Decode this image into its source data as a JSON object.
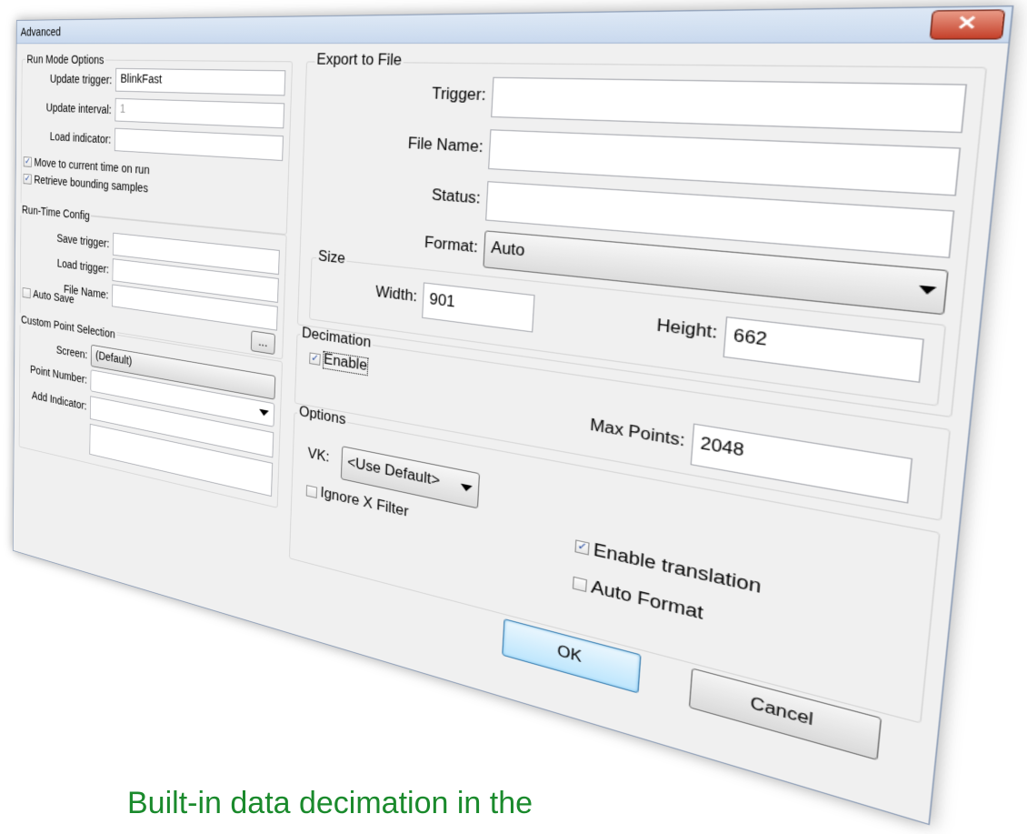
{
  "window": {
    "title": "Advanced",
    "close_glyph": "✕"
  },
  "run_mode": {
    "legend": "Run Mode Options",
    "update_trigger_label": "Update trigger:",
    "update_trigger_value": "BlinkFast",
    "update_interval_label": "Update interval:",
    "update_interval_value": "1",
    "load_indicator_label": "Load indicator:",
    "load_indicator_value": "",
    "move_to_current_label": "Move to current time on run",
    "move_to_current_checked": true,
    "retrieve_bounding_label": "Retrieve bounding samples",
    "retrieve_bounding_checked": true
  },
  "runtime_config": {
    "legend": "Run-Time Config",
    "save_trigger_label": "Save trigger:",
    "load_trigger_label": "Load trigger:",
    "file_name_label": "File Name:",
    "auto_save_label": "Auto Save",
    "auto_save_checked": false,
    "browse_label": "..."
  },
  "custom_point": {
    "legend": "Custom Point Selection",
    "screen_label": "Screen:",
    "screen_value": "(Default)",
    "point_number_label": "Point Number:",
    "add_indicator_label": "Add Indicator:"
  },
  "export": {
    "legend": "Export to File",
    "trigger_label": "Trigger:",
    "file_name_label": "File Name:",
    "status_label": "Status:",
    "format_label": "Format:",
    "format_value": "Auto"
  },
  "size": {
    "legend": "Size",
    "width_label": "Width:",
    "width_value": "901",
    "height_label": "Height:",
    "height_value": "662"
  },
  "decimation": {
    "legend": "Decimation",
    "enable_label": "Enable",
    "enable_checked": true,
    "max_points_label": "Max Points:",
    "max_points_value": "2048"
  },
  "options": {
    "legend": "Options",
    "vk_label": "VK:",
    "vk_value": "<Use Default>",
    "ignore_x_filter_label": "Ignore X Filter",
    "ignore_x_filter_checked": false,
    "enable_translation_label": "Enable translation",
    "enable_translation_checked": true,
    "auto_format_label": "Auto Format",
    "auto_format_checked": false
  },
  "buttons": {
    "ok_label": "OK",
    "cancel_label": "Cancel"
  },
  "caption": "Built-in data decimation in the",
  "colors": {
    "caption": "#1a8a2c",
    "close_button": "#c4402a",
    "check_mark": "#2a4ea0"
  }
}
